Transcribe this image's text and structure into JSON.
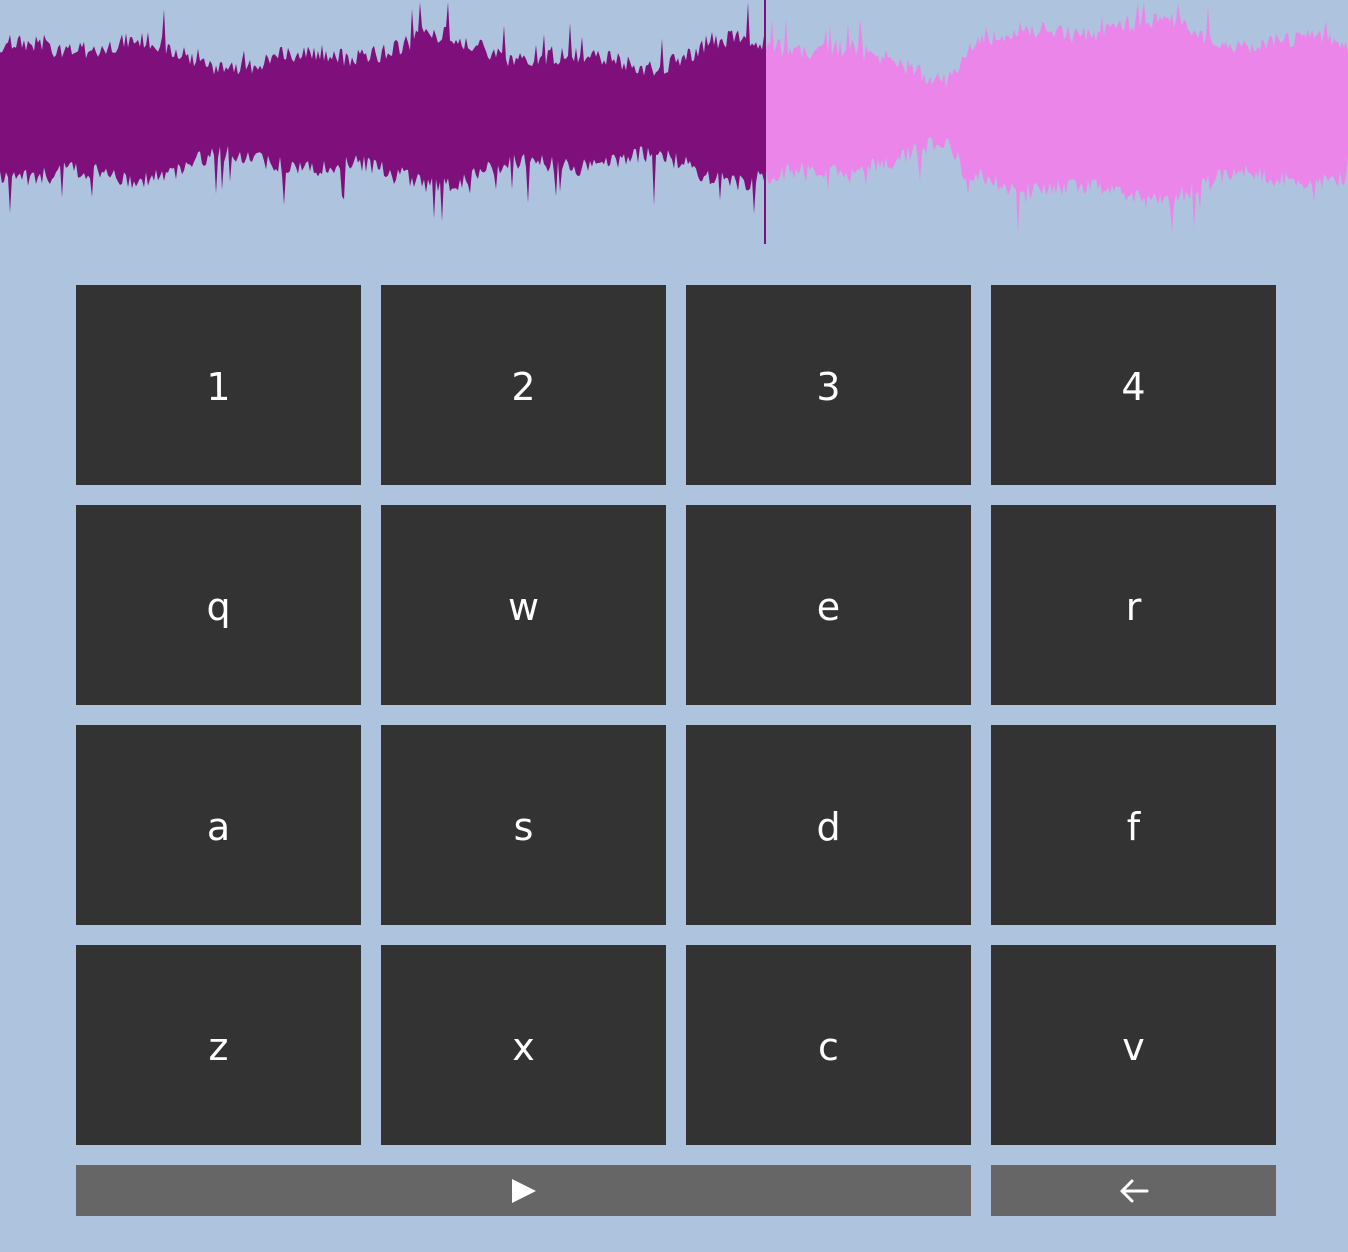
{
  "waveform": {
    "played_color": "#7f0f7b",
    "unplayed_color": "#ec85ea",
    "playhead_color": "#7f0f7b",
    "progress": 0.567
  },
  "pads": [
    {
      "label": "1"
    },
    {
      "label": "2"
    },
    {
      "label": "3"
    },
    {
      "label": "4"
    },
    {
      "label": "q"
    },
    {
      "label": "w"
    },
    {
      "label": "e"
    },
    {
      "label": "r"
    },
    {
      "label": "a"
    },
    {
      "label": "s"
    },
    {
      "label": "d"
    },
    {
      "label": "f"
    },
    {
      "label": "z"
    },
    {
      "label": "x"
    },
    {
      "label": "c"
    },
    {
      "label": "v"
    }
  ],
  "controls": {
    "play_icon": "play-icon",
    "back_icon": "arrow-left-icon"
  }
}
